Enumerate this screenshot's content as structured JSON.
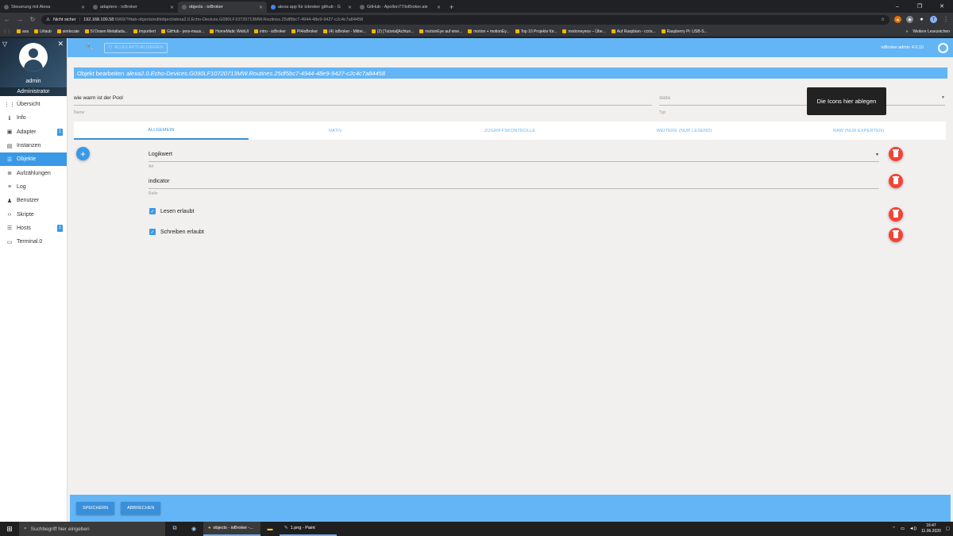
{
  "browser": {
    "tabs": [
      {
        "label": "Steuerung mit Alexa",
        "active": false
      },
      {
        "label": "adapters - ioBroker",
        "active": false
      },
      {
        "label": "objects - ioBroker",
        "active": true
      },
      {
        "label": "alexa app für iobroker github - G",
        "active": false
      },
      {
        "label": "GitHub - Apollon77/ioBroker.ale",
        "active": false
      }
    ],
    "address": {
      "security": "Nicht sicher",
      "host": "192.168.100.58",
      "path": ":6969/?#tab-objects/editobject/alexa2.0.Echo-Devices.G090LF10720713MW.Routines.25df5bc7-4944-48e9-9427-c2c4c7a84458"
    },
    "bookmarks": [
      "axa",
      "Urlaub",
      "simlocate",
      "5l Dosen Metallada...",
      "Importiert",
      "GitHub - jens-maus...",
      "HomeMatic WebUI",
      "intro - ioBroker",
      "PI4ioBroker",
      "(4) ioBroker - Mittei...",
      "(2) [Tutorial]Achtun...",
      "motionEye auf eine...",
      "motion + motionEy...",
      "Top 10 Projekte für...",
      "motioneyeos – Übe...",
      "Auf Raspbian - ccris...",
      "Raspberry Pi: USB-S..."
    ],
    "bookmarks_more": "»",
    "bookmarks_other": "Weitere Lesezeichen"
  },
  "sidebar": {
    "user_name": "admin",
    "user_role": "Administrator",
    "items": [
      {
        "label": "Übersicht",
        "icon": "grid-icon",
        "glyph": "⋮⋮",
        "badge": ""
      },
      {
        "label": "Info",
        "icon": "info-icon",
        "glyph": "ℹ",
        "badge": ""
      },
      {
        "label": "Adapter",
        "icon": "adapter-icon",
        "glyph": "▣",
        "badge": "1"
      },
      {
        "label": "Instanzen",
        "icon": "instances-icon",
        "glyph": "▤",
        "badge": ""
      },
      {
        "label": "Objekte",
        "icon": "objects-icon",
        "glyph": "☰",
        "badge": ""
      },
      {
        "label": "Aufzählungen",
        "icon": "enums-icon",
        "glyph": "≣",
        "badge": ""
      },
      {
        "label": "Log",
        "icon": "log-icon",
        "glyph": "≡",
        "badge": ""
      },
      {
        "label": "Benutzer",
        "icon": "user-icon",
        "glyph": "♟",
        "badge": ""
      },
      {
        "label": "Skripte",
        "icon": "code-icon",
        "glyph": "‹›",
        "badge": ""
      },
      {
        "label": "Hosts",
        "icon": "hosts-icon",
        "glyph": "☰",
        "badge": "1"
      },
      {
        "label": "Terminal.0",
        "icon": "terminal-icon",
        "glyph": "▭",
        "badge": ""
      }
    ]
  },
  "topbar": {
    "ghost_button": "ALLES AKTUALISIEREN",
    "version": "ioBroker.admin 4.0.10"
  },
  "editor": {
    "title_prefix": "Objekt bearbeiten",
    "object_id": "alexa2.0.Echo-Devices.G090LF10720713MW.Routines.25df5bc7-4944-48e9-9427-c2c4c7a84458",
    "name_value": "wie warm ist der Pool",
    "name_label": "Name",
    "type_value": "state",
    "type_label": "Typ",
    "tooltip": "Die Icons hier ablegen",
    "tabs": [
      "ALLGEMEIN",
      "NATIV",
      "ZUGRIFFSKONTROLLE",
      "WEITERE (NUR LESEND)",
      "RAW (NUR EXPERTEN)"
    ],
    "active_tab": "ALLGEMEIN",
    "props": {
      "type_value": "Logikwert",
      "type_label": "Art",
      "role_value": "indicator",
      "role_label": "Rolle",
      "read_label": "Lesen erlaubt",
      "read_checked": true,
      "write_label": "Schreiben erlaubt",
      "write_checked": true
    }
  },
  "footer": {
    "save": "SPEICHERN",
    "cancel": "ABBRECHEN"
  },
  "taskbar": {
    "search_placeholder": "Suchbegriff hier eingeben",
    "tasks": [
      "objects - ioBroker -...",
      "1.png - Paint"
    ],
    "time": "16:47",
    "date": "11.06.2020"
  },
  "colors": {
    "accent": "#64b5f6",
    "accent_dark": "#3a8fd9",
    "delete": "#f44336"
  }
}
